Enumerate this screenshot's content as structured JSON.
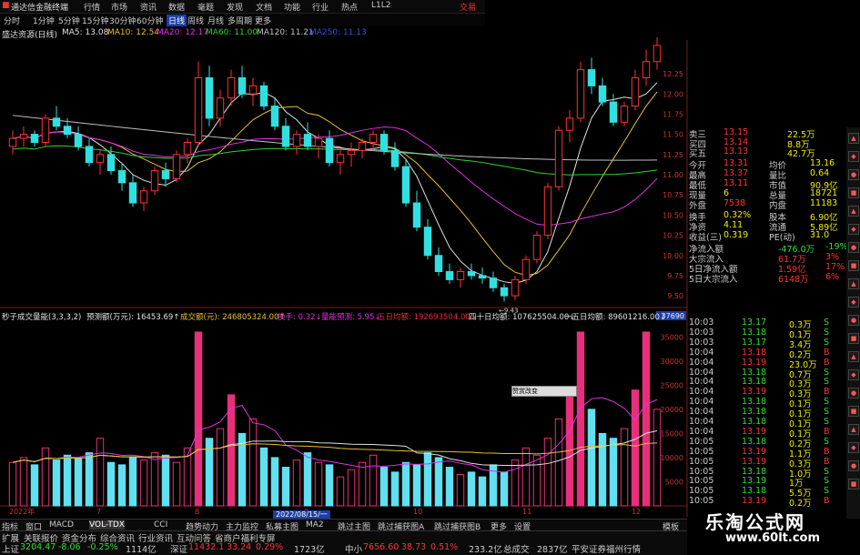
{
  "title_bar": {
    "app_name": "通达信金融终端",
    "menus": [
      "行情",
      "市场",
      "资讯",
      "数据",
      "毫题",
      "发现",
      "文档",
      "功能",
      "行业",
      "热点",
      "L1L2"
    ],
    "trade_button": "交易"
  },
  "period_bar": {
    "periods": [
      "分时",
      "1分钟",
      "5分钟",
      "15分钟",
      "30分钟",
      "60分钟",
      "日线",
      "周线",
      "月线",
      "多周期",
      "更多"
    ],
    "active": "日线"
  },
  "ma_legend": {
    "stock_name": "盛达资源(日线)",
    "items": [
      {
        "label": "MA5: 13.08",
        "color": "#e0e0e0"
      },
      {
        "label": "MA10: 12.54",
        "color": "#e8c030"
      },
      {
        "label": "MA20: 12.17",
        "color": "#e030e0"
      },
      {
        "label": "MA60: 11.00",
        "color": "#30d030"
      },
      {
        "label": "MA120: 11.21",
        "color": "#c0c0c0"
      },
      {
        "label": "MA250: 11.13",
        "color": "#3050e0"
      }
    ]
  },
  "price_axis": [
    "12.25",
    "12.00",
    "11.75",
    "11.50",
    "11.25",
    "11.00",
    "10.75",
    "10.50",
    "10.25",
    "10.00",
    "9.75",
    "9.50"
  ],
  "low_marker": "9.43",
  "volume_legend": [
    {
      "label": "秒子成交量能(3,3,3,2)",
      "color": "#e0e0e0"
    },
    {
      "label": "预测额(万元): 16453.69↑",
      "color": "#e0e0e0"
    },
    {
      "label": "成交额(元): 246805324.00↑",
      "color": "#e8c030"
    },
    {
      "label": "换手: 0.32↓",
      "color": "#e030e0"
    },
    {
      "label": "量能预测: 5.95↓",
      "color": "#e030e0"
    },
    {
      "label": "五日均额: 192693504.00↓",
      "color": "#e03030"
    },
    {
      "label": "四十日均额: 107625504.00↓",
      "color": "#e0e0e0"
    },
    {
      "label": "一五日均额: 89601216.00↓",
      "color": "#e0e0e0"
    }
  ],
  "volume_axis": [
    "35000",
    "30000",
    "25000",
    "20000",
    "15000",
    "10000",
    "5000"
  ],
  "volume_axis_top": "37690",
  "date_labels": [
    "2022年",
    "7",
    "8",
    "9",
    "10",
    "11",
    "12"
  ],
  "cursor_date": "2022/08/15/一",
  "popup_label": "赞赏改变",
  "quote_panel": {
    "order_book": [
      {
        "label": "卖三",
        "price": "13.15",
        "vol": "22.5万"
      },
      {
        "label": "买四",
        "price": "13.14",
        "vol": "8.8万"
      },
      {
        "label": "买五",
        "price": "13.13",
        "vol": "42.7万"
      }
    ],
    "stats": [
      {
        "l1": "今开",
        "v1": "13.31",
        "l2": "均价",
        "v2": "13.16"
      },
      {
        "l1": "最高",
        "v1": "13.37",
        "l2": "量比",
        "v2": "0.64"
      },
      {
        "l1": "最低",
        "v1": "13.11",
        "l2": "市值",
        "v2": "90.9亿"
      },
      {
        "l1": "现量",
        "v1": "6",
        "l2": "总量",
        "v2": "18721"
      },
      {
        "l1": "外盘",
        "v1": "7538",
        "l2": "内盘",
        "v2": "11183"
      }
    ],
    "stats2": [
      {
        "l1": "换手",
        "v1": "0.32%",
        "l2": "股本",
        "v2": "6.90亿"
      },
      {
        "l1": "净资",
        "v1": "4.11",
        "l2": "流通",
        "v2": "5.89亿"
      },
      {
        "l1": "收益(三)",
        "v1": "0.319",
        "l2": "PE(动)",
        "v2": "31.0"
      }
    ],
    "flows": [
      {
        "label": "净流入额",
        "value": "-476.0万",
        "pct": "-19%"
      },
      {
        "label": "大宗流入",
        "value": "61.7万",
        "pct": "3%"
      },
      {
        "label": "5日净流入额",
        "value": "1.59亿",
        "pct": "17%"
      },
      {
        "label": "5日大宗流入",
        "value": "6148万",
        "pct": "6%"
      }
    ],
    "ticks": [
      {
        "time": "10:03",
        "price": "13.17",
        "vol": "0.3万",
        "side": "S"
      },
      {
        "time": "10:03",
        "price": "13.18",
        "vol": "0.1万",
        "side": "S"
      },
      {
        "time": "10:03",
        "price": "13.17",
        "vol": "3.4万",
        "side": "S"
      },
      {
        "time": "10:04",
        "price": "13.18",
        "vol": "0.2万",
        "side": "B"
      },
      {
        "time": "10:04",
        "price": "13.19",
        "vol": "23.0万",
        "side": "B"
      },
      {
        "time": "10:04",
        "price": "13.18",
        "vol": "0.7万",
        "side": "S"
      },
      {
        "time": "10:04",
        "price": "13.18",
        "vol": "0.3万",
        "side": "S"
      },
      {
        "time": "10:04",
        "price": "13.19",
        "vol": "0.3万",
        "side": "B"
      },
      {
        "time": "10:04",
        "price": "13.18",
        "vol": "0.1万",
        "side": "S"
      },
      {
        "time": "10:04",
        "price": "13.18",
        "vol": "0.1万",
        "side": "S"
      },
      {
        "time": "10:04",
        "price": "13.18",
        "vol": "0.1万",
        "side": "S"
      },
      {
        "time": "10:04",
        "price": "13.19",
        "vol": "0.1万",
        "side": "B"
      },
      {
        "time": "10:05",
        "price": "13.18",
        "vol": "0.2万",
        "side": "S"
      },
      {
        "time": "10:05",
        "price": "13.19",
        "vol": "1.1万",
        "side": "B"
      },
      {
        "time": "10:05",
        "price": "13.19",
        "vol": "0.3万",
        "side": "B"
      },
      {
        "time": "10:05",
        "price": "13.18",
        "vol": "1.0万",
        "side": "S"
      },
      {
        "time": "10:05",
        "price": "13.19",
        "vol": "1万",
        "side": "S"
      },
      {
        "time": "10:05",
        "price": "13.18",
        "vol": "5.5万",
        "side": "S"
      },
      {
        "time": "10:05",
        "price": "13.19",
        "vol": "0.2万",
        "side": "B"
      }
    ],
    "tick_header": "10:03"
  },
  "indicator_tabs": [
    "指标",
    "窗口",
    "MACD",
    "VOL-TDX",
    "CCI",
    "趋势动力",
    "主力监控",
    "私募主图",
    "MA2",
    "跳过主图",
    "跳过捕获图A",
    "跳过捕获图B",
    "更多",
    "设置"
  ],
  "indicator_active": "VOL-TDX",
  "indicator_right": "模板",
  "status_bar": {
    "left_tabs": [
      "扩展",
      "关联报价",
      "资金分布",
      "综合资讯",
      "行业资讯",
      "互动问答",
      "省商户福利专屏"
    ],
    "indices": [
      {
        "name": "上证",
        "value": "3204.47",
        "chg": "-8.06",
        "pct": "-0.25%",
        "amt": "1114亿"
      },
      {
        "name": "深证",
        "value": "11432.1",
        "chg": "33.24",
        "pct": "0.29%",
        "amt": "1723亿"
      },
      {
        "name": "中小",
        "value": "7656.60",
        "chg": "38.73",
        "pct": "0.51%",
        "amt": "233.2亿"
      }
    ],
    "total_label": "总成交",
    "total_value": "2837亿",
    "broker": "平安证券福州行情"
  },
  "watermark": {
    "line1": "乐淘公式网",
    "line2": "www.60lt.com"
  },
  "colors": {
    "up": "#ff3030",
    "down": "#30e0e0",
    "ma5": "#e0e0e0",
    "ma10": "#e8c030",
    "ma20": "#e030e0",
    "ma60": "#30d030",
    "ma120": "#c0c0c0",
    "ma250": "#3050e0",
    "vol_up": "#e8307a",
    "vol_down": "#60e0f0"
  },
  "chart_data": {
    "type": "candlestick",
    "note_units": "price CNY; volume in 万 (x10k) scale as axis",
    "candles": [
      [
        11.35,
        11.55,
        11.25,
        11.45
      ],
      [
        11.45,
        11.6,
        11.35,
        11.5
      ],
      [
        11.5,
        11.55,
        11.35,
        11.4
      ],
      [
        11.4,
        11.75,
        11.35,
        11.7
      ],
      [
        11.7,
        11.85,
        11.55,
        11.6
      ],
      [
        11.6,
        11.7,
        11.45,
        11.5
      ],
      [
        11.5,
        11.6,
        11.3,
        11.35
      ],
      [
        11.35,
        11.45,
        11.1,
        11.15
      ],
      [
        11.15,
        11.3,
        11.0,
        11.25
      ],
      [
        11.25,
        11.35,
        11.0,
        11.05
      ],
      [
        11.05,
        11.15,
        10.8,
        10.9
      ],
      [
        10.9,
        11.0,
        10.6,
        10.65
      ],
      [
        10.65,
        10.85,
        10.55,
        10.8
      ],
      [
        10.8,
        11.1,
        10.75,
        11.05
      ],
      [
        11.05,
        11.15,
        10.85,
        10.95
      ],
      [
        10.95,
        11.3,
        10.9,
        11.25
      ],
      [
        11.25,
        11.45,
        11.15,
        11.4
      ],
      [
        11.4,
        12.4,
        11.35,
        12.2
      ],
      [
        12.2,
        12.35,
        11.6,
        11.7
      ],
      [
        11.7,
        12.05,
        11.6,
        11.95
      ],
      [
        11.95,
        12.3,
        11.85,
        12.2
      ],
      [
        12.2,
        12.35,
        11.95,
        12.0
      ],
      [
        12.0,
        12.2,
        11.85,
        12.1
      ],
      [
        12.1,
        12.15,
        11.8,
        11.85
      ],
      [
        11.85,
        11.95,
        11.55,
        11.6
      ],
      [
        11.6,
        11.7,
        11.3,
        11.35
      ],
      [
        11.35,
        11.55,
        11.25,
        11.5
      ],
      [
        11.5,
        11.65,
        11.3,
        11.35
      ],
      [
        11.35,
        11.5,
        11.2,
        11.45
      ],
      [
        11.45,
        11.55,
        11.1,
        11.15
      ],
      [
        11.15,
        11.3,
        11.0,
        11.25
      ],
      [
        11.25,
        11.4,
        11.1,
        11.3
      ],
      [
        11.3,
        11.45,
        11.2,
        11.4
      ],
      [
        11.4,
        11.55,
        11.3,
        11.5
      ],
      [
        11.5,
        11.55,
        11.25,
        11.3
      ],
      [
        11.3,
        11.4,
        11.05,
        11.1
      ],
      [
        11.1,
        11.2,
        10.6,
        10.65
      ],
      [
        10.65,
        10.8,
        10.3,
        10.35
      ],
      [
        10.35,
        10.45,
        9.95,
        10.0
      ],
      [
        10.0,
        10.1,
        9.75,
        9.8
      ],
      [
        9.8,
        9.9,
        9.65,
        9.7
      ],
      [
        9.7,
        9.85,
        9.6,
        9.8
      ],
      [
        9.8,
        9.9,
        9.7,
        9.75
      ],
      [
        9.75,
        9.85,
        9.65,
        9.72
      ],
      [
        9.72,
        9.8,
        9.55,
        9.6
      ],
      [
        9.6,
        9.65,
        9.43,
        9.5
      ],
      [
        9.5,
        9.75,
        9.45,
        9.7
      ],
      [
        9.7,
        10.0,
        9.65,
        9.95
      ],
      [
        9.95,
        10.3,
        9.9,
        10.25
      ],
      [
        10.25,
        10.9,
        10.2,
        10.85
      ],
      [
        10.85,
        11.6,
        10.8,
        11.55
      ],
      [
        11.55,
        11.8,
        11.4,
        11.7
      ],
      [
        11.7,
        12.4,
        11.65,
        12.3
      ],
      [
        12.3,
        12.45,
        12.0,
        12.1
      ],
      [
        12.1,
        12.2,
        11.85,
        11.9
      ],
      [
        11.9,
        12.0,
        11.6,
        11.65
      ],
      [
        11.65,
        11.9,
        11.6,
        11.85
      ],
      [
        11.85,
        12.3,
        11.8,
        12.2
      ],
      [
        12.2,
        12.55,
        12.1,
        12.4
      ],
      [
        12.4,
        12.7,
        12.3,
        12.6
      ]
    ],
    "volume_x10k": [
      9000,
      10000,
      8500,
      12000,
      9500,
      10500,
      9800,
      11000,
      14000,
      9000,
      8500,
      10000,
      9500,
      11000,
      10500,
      9000,
      12000,
      36000,
      14000,
      16000,
      23000,
      15000,
      18000,
      12000,
      10000,
      8000,
      9500,
      11000,
      9000,
      8500,
      6000,
      7500,
      9000,
      10500,
      8000,
      7000,
      9000,
      8500,
      11000,
      10000,
      8000,
      6500,
      7000,
      6000,
      8500,
      7000,
      9500,
      12000,
      10500,
      14000,
      18000,
      23000,
      36000,
      20000,
      15000,
      14000,
      16000,
      24000,
      36000,
      20000
    ],
    "ylim_price": [
      9.4,
      12.6
    ],
    "ylim_volume": [
      0,
      37690
    ]
  }
}
